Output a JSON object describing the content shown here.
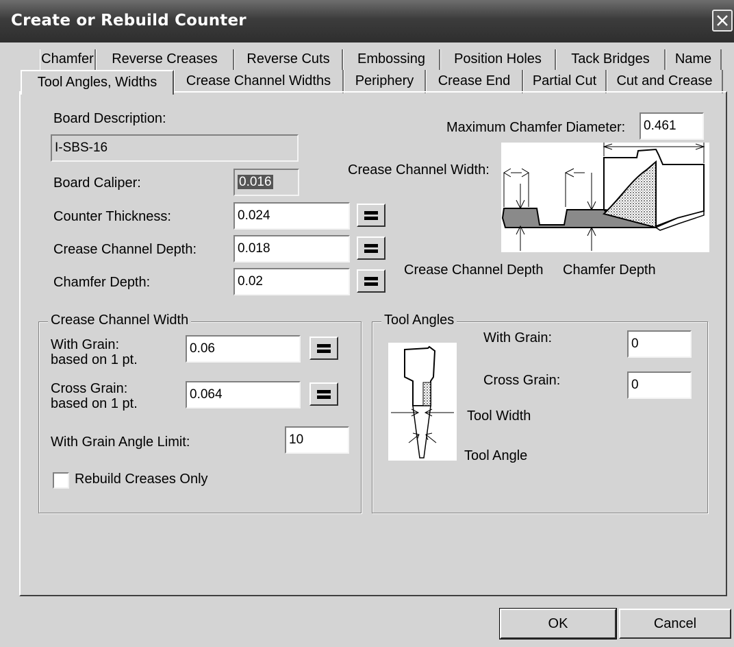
{
  "window": {
    "title": "Create or Rebuild Counter"
  },
  "tabs_row1": [
    "Chamfer",
    "Reverse Creases",
    "Reverse Cuts",
    "Embossing",
    "Position Holes",
    "Tack Bridges",
    "Name"
  ],
  "tabs_row2": [
    "Tool Angles, Widths",
    "Crease Channel Widths",
    "Periphery",
    "Crease End",
    "Partial Cut",
    "Cut and Crease"
  ],
  "active_tab": "Tool Angles, Widths",
  "board": {
    "description_label": "Board Description:",
    "description_value": "I-SBS-16",
    "caliper_label": "Board Caliper:",
    "caliper_value": "0.016",
    "counter_thickness_label": "Counter Thickness:",
    "counter_thickness_value": "0.024",
    "crease_channel_depth_label": "Crease Channel Depth:",
    "crease_channel_depth_value": "0.018",
    "chamfer_depth_label": "Chamfer Depth:",
    "chamfer_depth_value": "0.02"
  },
  "chamfer": {
    "max_diameter_label": "Maximum Chamfer Diameter:",
    "max_diameter_value": "0.461"
  },
  "diagram_labels": {
    "crease_channel_width": "Crease Channel Width:",
    "crease_channel_depth": "Crease Channel Depth",
    "chamfer_depth": "Chamfer Depth",
    "tool_width": "Tool Width",
    "tool_angle": "Tool Angle"
  },
  "crease_group": {
    "title": "Crease Channel Width",
    "with_grain_label_1": "With Grain:",
    "with_grain_label_2": "based on 1 pt.",
    "with_grain_value": "0.06",
    "cross_grain_label_1": "Cross Grain:",
    "cross_grain_label_2": "based on 1 pt.",
    "cross_grain_value": "0.064",
    "angle_limit_label": "With Grain Angle Limit:",
    "angle_limit_value": "10",
    "rebuild_label": "Rebuild Creases Only",
    "rebuild_checked": false
  },
  "tool_group": {
    "title": "Tool Angles",
    "with_grain_label": "With Grain:",
    "with_grain_value": "0",
    "cross_grain_label": "Cross Grain:",
    "cross_grain_value": "0"
  },
  "buttons": {
    "ok": "OK",
    "cancel": "Cancel"
  }
}
